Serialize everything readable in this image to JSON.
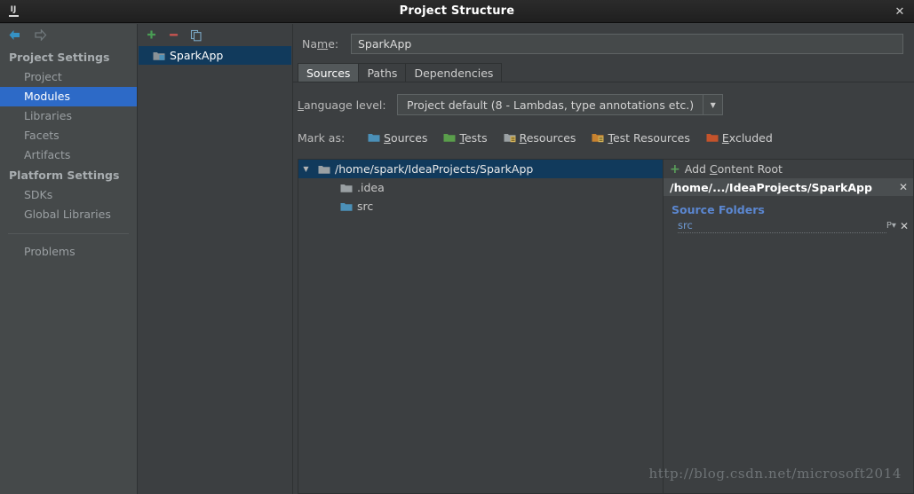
{
  "window": {
    "title": "Project Structure",
    "app_icon": "IJ",
    "close_label": "✕"
  },
  "nav": {
    "back_icon": "arrow-left-icon",
    "forward_icon": "arrow-right-icon",
    "groups": [
      {
        "label": "Project Settings",
        "items": [
          {
            "label": "Project",
            "selected": false
          },
          {
            "label": "Modules",
            "selected": true
          },
          {
            "label": "Libraries",
            "selected": false
          },
          {
            "label": "Facets",
            "selected": false
          },
          {
            "label": "Artifacts",
            "selected": false
          }
        ]
      },
      {
        "label": "Platform Settings",
        "items": [
          {
            "label": "SDKs",
            "selected": false
          },
          {
            "label": "Global Libraries",
            "selected": false
          }
        ]
      }
    ],
    "problems": "Problems"
  },
  "modules": {
    "toolbar": {
      "add": "+",
      "remove": "−",
      "copy_icon": "copy-icon"
    },
    "items": [
      {
        "label": "SparkApp",
        "selected": true
      }
    ]
  },
  "detail": {
    "name_label_pre": "Na",
    "name_label_mn": "m",
    "name_label_post": "e:",
    "name_value": "SparkApp",
    "tabs": [
      {
        "label": "Sources",
        "active": true
      },
      {
        "label": "Paths",
        "active": false
      },
      {
        "label": "Dependencies",
        "active": false
      }
    ],
    "language_level": {
      "label_mn": "L",
      "label_rest": "anguage level:",
      "value": "Project default (8 - Lambdas, type annotations etc.)",
      "arrow": "▼"
    },
    "mark_as": {
      "label": "Mark as:",
      "options": [
        {
          "mn": "S",
          "rest": "ources",
          "icon": "folder-sources-icon",
          "color": "#4b90b8"
        },
        {
          "mn": "T",
          "rest": "ests",
          "icon": "folder-tests-icon",
          "color": "#5a9e4b"
        },
        {
          "mn": "R",
          "rest": "esources",
          "icon": "folder-resources-icon",
          "color": "#9aa0a3"
        },
        {
          "mn": "T",
          "rest": "est Resources",
          "icon": "folder-test-resources-icon",
          "color": "#c8822f"
        },
        {
          "mn": "E",
          "rest": "xcluded",
          "icon": "folder-excluded-icon",
          "color": "#c4532b"
        }
      ]
    },
    "tree": [
      {
        "label": "/home/spark/IdeaProjects/SparkApp",
        "level": 0,
        "expanded": true,
        "selected": true,
        "folder_color": "#9aa0a3"
      },
      {
        "label": ".idea",
        "level": 1,
        "expanded": false,
        "selected": false,
        "folder_color": "#9aa0a3"
      },
      {
        "label": "src",
        "level": 1,
        "expanded": false,
        "selected": false,
        "folder_color": "#4b90b8"
      }
    ],
    "content_roots": {
      "add_label_pre": "Add ",
      "add_label_mn": "C",
      "add_label_post": "ontent Root",
      "root_path": "/home/.../IdeaProjects/SparkApp",
      "root_remove": "✕",
      "source_folders_title": "Source Folders",
      "source_folders": [
        {
          "name": "src",
          "package_prefix_icon": "P",
          "remove_icon": "✕"
        }
      ]
    }
  },
  "watermark": "http://blog.csdn.net/microsoft2014"
}
